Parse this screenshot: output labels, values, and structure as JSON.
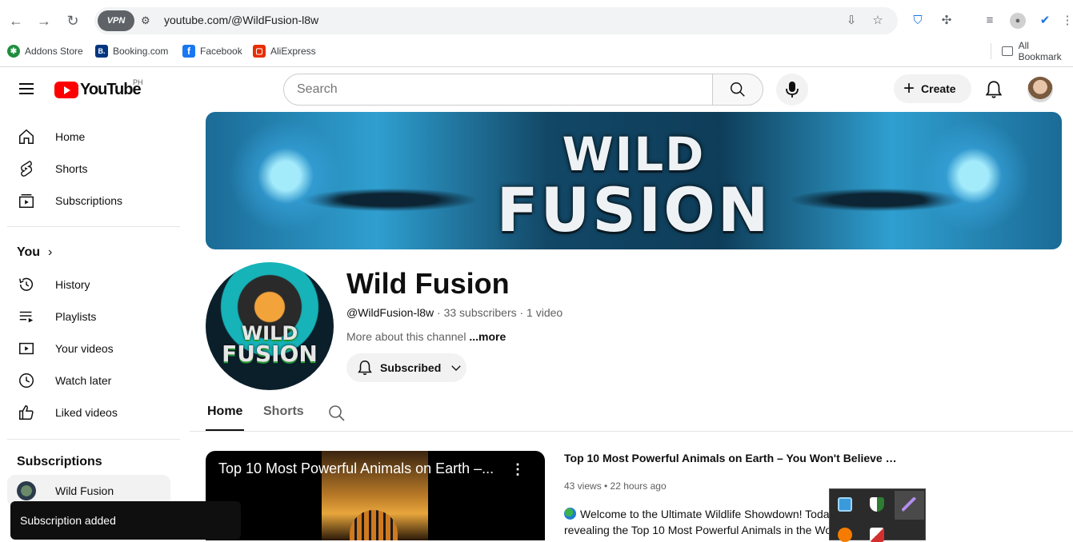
{
  "browser": {
    "vpn_label": "VPN",
    "url": "youtube.com/@WildFusion-l8w",
    "bookmarks": [
      {
        "label": "Addons Store",
        "color": "#1e8e3e",
        "glyph": "✱"
      },
      {
        "label": "Booking.com",
        "color": "#003580",
        "glyph": "B."
      },
      {
        "label": "Facebook",
        "color": "#1877f2",
        "glyph": "f"
      },
      {
        "label": "AliExpress",
        "color": "#e62e04",
        "glyph": "▢"
      }
    ],
    "all_bookmarks": "All Bookmark"
  },
  "header": {
    "logo_text": "YouTube",
    "country_code": "PH",
    "search_placeholder": "Search",
    "create_label": "Create"
  },
  "sidebar": {
    "main": [
      {
        "label": "Home",
        "icon": "home-icon"
      },
      {
        "label": "Shorts",
        "icon": "shorts-icon"
      },
      {
        "label": "Subscriptions",
        "icon": "subscriptions-icon"
      }
    ],
    "you_heading": "You",
    "you_items": [
      {
        "label": "History",
        "icon": "history-icon"
      },
      {
        "label": "Playlists",
        "icon": "playlists-icon"
      },
      {
        "label": "Your videos",
        "icon": "your-videos-icon"
      },
      {
        "label": "Watch later",
        "icon": "watch-later-icon"
      },
      {
        "label": "Liked videos",
        "icon": "liked-videos-icon"
      }
    ],
    "subscriptions_heading": "Subscriptions",
    "subscriptions": [
      {
        "label": "Wild Fusion"
      }
    ]
  },
  "channel": {
    "banner_line1": "WILD",
    "banner_line2": "FUSION",
    "avatar_line1": "WILD",
    "avatar_line2": "FUSION",
    "name": "Wild Fusion",
    "handle": "@WildFusion-l8w",
    "meta_rest": " · 33 subscribers · 1 video",
    "about": "More about this channel ",
    "about_more": "...more",
    "subscribed_label": "Subscribed"
  },
  "tabs": [
    {
      "label": "Home",
      "active": true
    },
    {
      "label": "Shorts",
      "active": false
    }
  ],
  "video": {
    "thumb_title": "Top 10 Most Powerful Animals on Earth –...",
    "title": "Top 10 Most Powerful Animals on Earth – You Won't Believe #...",
    "stats": "43 views • 22 hours ago",
    "desc_line1": "Welcome to the Ultimate Wildlife Showdown! Today",
    "desc_line2": "revealing the Top 10 Most Powerful Animals in the Wo"
  },
  "toast": {
    "message": "Subscription added"
  }
}
